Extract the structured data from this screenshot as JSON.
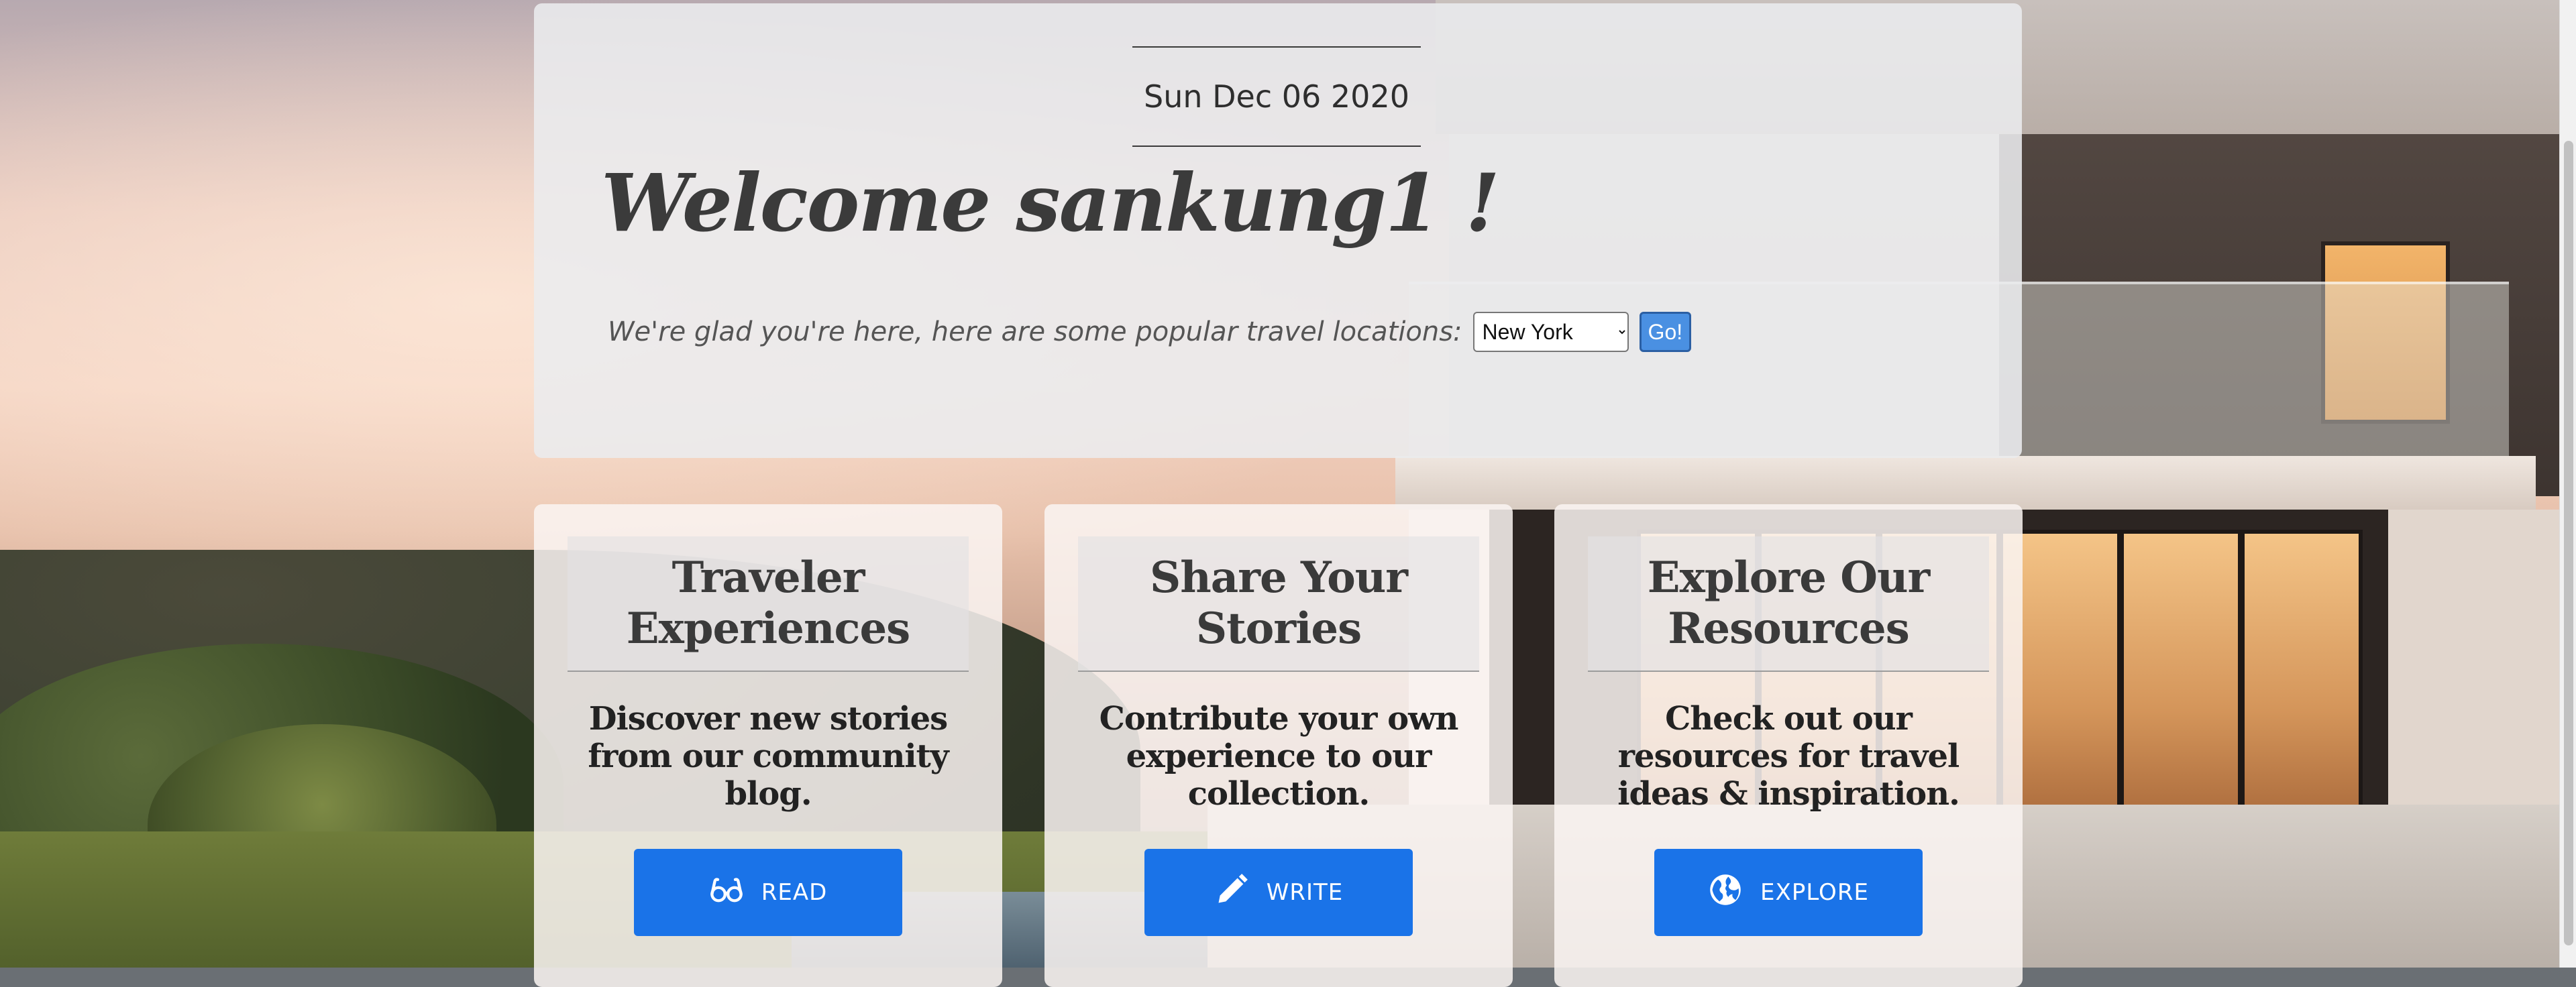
{
  "header": {
    "date": "Sun Dec 06 2020",
    "welcome_title": "Welcome sankung1 !",
    "glad_text": "We're glad you're here, here are some popular travel locations:",
    "location_select": {
      "selected": "New York"
    },
    "go_label": "Go!"
  },
  "cards": [
    {
      "title": "Traveler\nExperiences",
      "description": "Discover new stories from our community blog.",
      "button_label": "READ",
      "icon": "glasses-icon"
    },
    {
      "title": "Share Your\nStories",
      "description": "Contribute your own experience to our collection.",
      "button_label": "WRITE",
      "icon": "pencil-icon"
    },
    {
      "title": "Explore Our\nResources",
      "description": "Check out our resources for travel ideas & inspiration.",
      "button_label": "EXPLORE",
      "icon": "globe-icon"
    }
  ],
  "colors": {
    "button_blue": "#1a73e8",
    "go_blue": "#4a90e2"
  }
}
